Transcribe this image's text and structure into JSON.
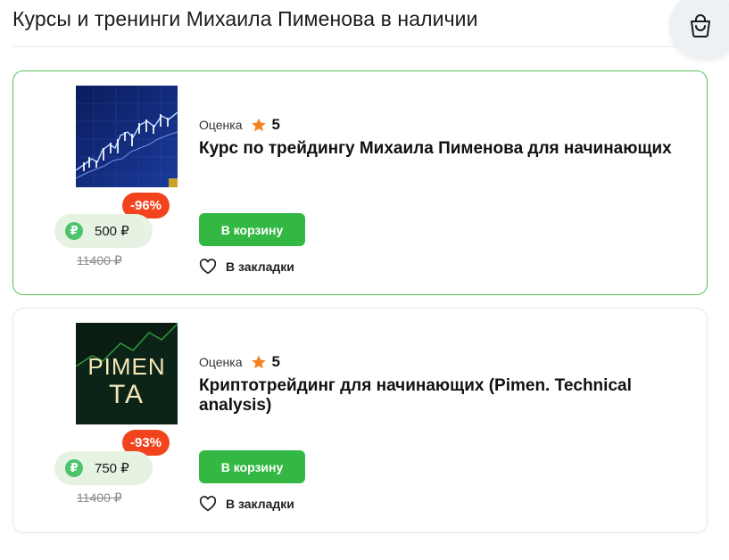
{
  "header": {
    "title": "Курсы и тренинги Михаила Пименова в наличии",
    "cart_icon": "shopping-bag-icon"
  },
  "colors": {
    "accent_green": "#33b844",
    "discount_red": "#f2431e",
    "star_orange": "#f58220",
    "active_border": "#57c05f"
  },
  "courses": [
    {
      "rating_label": "Оценка",
      "rating": "5",
      "title": "Курс по трейдингу Михаила Пименова для начинающих",
      "discount": "-96%",
      "currency_icon": "₽",
      "price": "500 ₽",
      "old_price": "11400 ₽",
      "cart_label": "В корзину",
      "bookmark_label": "В закладки",
      "thumb_icon": "trading-chart-image"
    },
    {
      "rating_label": "Оценка",
      "rating": "5",
      "title": "Криптотрейдинг для начинающих (Pimen. Technical analysis)",
      "discount": "-93%",
      "currency_icon": "₽",
      "price": "750 ₽",
      "old_price": "11400 ₽",
      "cart_label": "В корзину",
      "bookmark_label": "В закладки",
      "thumb_logo_line1": "PIMEN",
      "thumb_logo_line2": "TA"
    }
  ]
}
